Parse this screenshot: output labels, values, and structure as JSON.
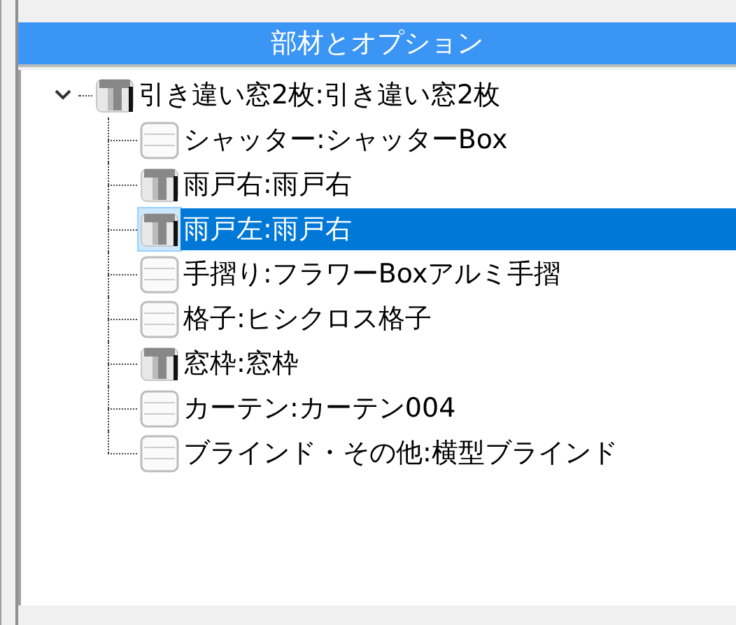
{
  "panel": {
    "title": "部材とオプション"
  },
  "tree": [
    {
      "label": "引き違い窓2枚:引き違い窓2枚",
      "kind": "solid",
      "expanded": true,
      "selected": false,
      "children": [
        {
          "label": "シャッター:シャッターBox",
          "kind": "empty",
          "selected": false
        },
        {
          "label": "雨戸右:雨戸右",
          "kind": "solid",
          "selected": false
        },
        {
          "label": "雨戸左:雨戸右",
          "kind": "solid",
          "selected": true
        },
        {
          "label": "手摺り:フラワーBoxアルミ手摺",
          "kind": "empty",
          "selected": false
        },
        {
          "label": "格子:ヒシクロス格子",
          "kind": "empty",
          "selected": false
        },
        {
          "label": "窓枠:窓枠",
          "kind": "solid",
          "selected": false
        },
        {
          "label": "カーテン:カーテン004",
          "kind": "empty",
          "selected": false
        },
        {
          "label": "ブラインド・その他:横型ブラインド",
          "kind": "empty",
          "selected": false
        }
      ]
    }
  ]
}
